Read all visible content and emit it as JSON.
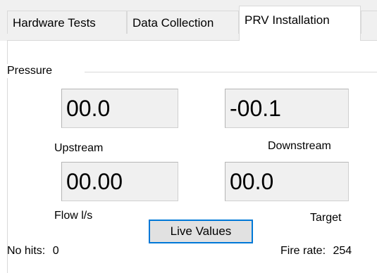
{
  "tabs": [
    {
      "label": "Hardware Tests"
    },
    {
      "label": "Data Collection"
    },
    {
      "label": "PRV Installation",
      "selected": true
    },
    {
      "label": ""
    }
  ],
  "pressure_group": {
    "title": "Pressure",
    "upstream": {
      "value": "00.0",
      "label": "Upstream"
    },
    "downstream": {
      "value": "-00.1",
      "label": "Downstream"
    },
    "flow": {
      "value": "00.00",
      "label": "Flow l/s"
    },
    "target": {
      "value": "00.0",
      "label": "Target"
    }
  },
  "live_values_button": {
    "label": "Live Values"
  },
  "status": {
    "no_hits_label": "No hits:",
    "no_hits_value": "0",
    "fire_rate_label": "Fire rate:",
    "fire_rate_value": "254"
  },
  "colors": {
    "focus_border": "#0078d7",
    "readout_background": "#f0f0f0",
    "window_background": "#f0f0f0"
  }
}
